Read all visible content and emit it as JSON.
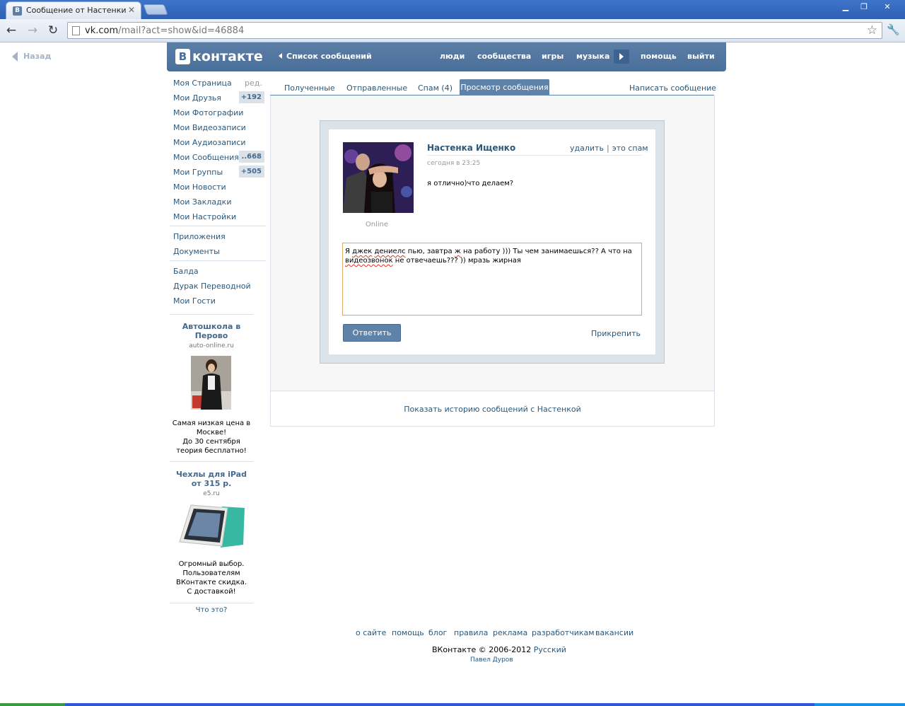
{
  "browser": {
    "tab_title": "Сообщение от Настенки Ищ",
    "url_host": "vk.com",
    "url_path": "/mail?act=show&id=46884"
  },
  "page": {
    "back_label": "Назад"
  },
  "header": {
    "logo_text": "контакте",
    "logo_letter": "B",
    "back_link": "Список сообщений",
    "nav": [
      "люди",
      "сообщества",
      "игры",
      "музыка",
      "помощь",
      "выйти"
    ]
  },
  "left_menu": {
    "items": [
      {
        "label": "Моя Страница",
        "aux": "ред."
      },
      {
        "label": "Мои Друзья",
        "badge": "+192"
      },
      {
        "label": "Мои Фотографии"
      },
      {
        "label": "Мои Видеозаписи"
      },
      {
        "label": "Мои Аудиозаписи"
      },
      {
        "label": "Мои Сообщения",
        "badge": "..668"
      },
      {
        "label": "Мои Группы",
        "badge": "+505"
      },
      {
        "label": "Мои Новости"
      },
      {
        "label": "Мои Закладки"
      },
      {
        "label": "Мои Настройки"
      }
    ],
    "apps": [
      "Приложения",
      "Документы"
    ],
    "games": [
      "Балда",
      "Дурак Переводной",
      "Мои Гости"
    ]
  },
  "ads": [
    {
      "title_line1": "Автошкола в",
      "title_line2": "Перово",
      "domain": "auto-online.ru",
      "text": [
        "Самая низкая цена в",
        "Москве!",
        "До 30 сентября",
        "теория бесплатно!"
      ]
    },
    {
      "title_line1": "Чехлы для iPad",
      "title_line2": "от 315 р.",
      "domain": "e5.ru",
      "text": [
        "Огромный выбор.",
        "Пользователям",
        "ВКонтакте скидка.",
        "С доставкой!"
      ]
    }
  ],
  "ads_what": "Что это?",
  "tabs": [
    {
      "label": "Полученные"
    },
    {
      "label": "Отправленные"
    },
    {
      "label": "Спам (4)"
    },
    {
      "label": "Просмотр сообщения",
      "active": true
    }
  ],
  "write_message": "Написать сообщение",
  "message": {
    "sender": "Настенка Ищенко",
    "status": "Online",
    "delete": "удалить",
    "spam": "это спам",
    "date": "сегодня в 23:25",
    "text": "я отлично)что делаем?"
  },
  "reply": {
    "parts": [
      "Я ",
      "джек",
      " ",
      "дениелс",
      " пью, завтра ",
      "ж",
      " на работу ))) Ты чем занимаешься?? А что на",
      "видеозвонок",
      " не отвечаешь??? )) мразь жирная"
    ],
    "send_label": "Ответить",
    "attach_label": "Прикрепить"
  },
  "history_link": "Показать историю сообщений с Настенкой",
  "footer": {
    "links": [
      "о сайте",
      "помощь",
      "блог",
      "правила",
      "реклама",
      "разработчикам",
      "вакансии"
    ],
    "copyright": "ВКонтакте © 2006-2012",
    "language": "Русский",
    "author": "Павел Дуров"
  },
  "colors": {
    "header_blue": "#5b7ea6",
    "link_blue": "#2b587a",
    "active_tab": "#5e82a8",
    "badge_bg": "#dae2e8"
  }
}
